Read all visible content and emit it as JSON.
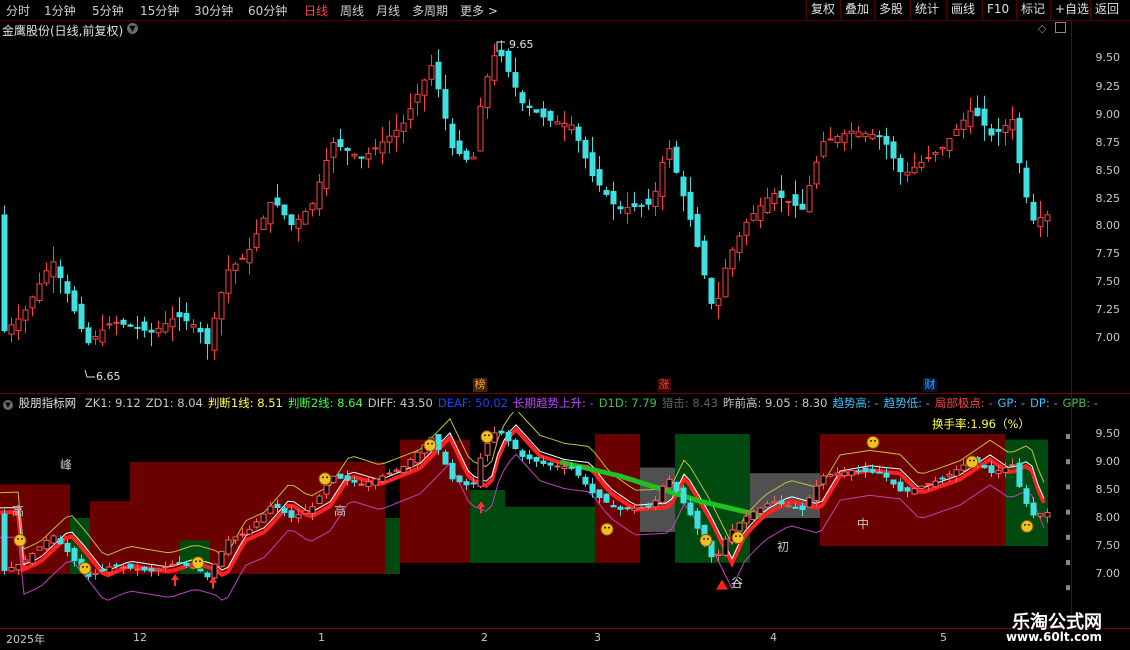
{
  "topbar": {
    "periods": [
      "分时",
      "1分钟",
      "5分钟",
      "15分钟",
      "30分钟",
      "60分钟",
      "日线",
      "周线",
      "月线",
      "多周期",
      "更多 >"
    ],
    "active_index": 6,
    "right_buttons": [
      "复权",
      "叠加",
      "多股",
      "统计",
      "画线",
      "F10",
      "标记",
      "+自选",
      "返回"
    ]
  },
  "stock": {
    "title": "金鹰股份(日线,前复权)",
    "high_mark": "9.65",
    "low_mark": "6.65"
  },
  "price_axis": [
    "9.50",
    "9.25",
    "9.00",
    "8.75",
    "8.50",
    "8.25",
    "8.00",
    "7.75",
    "7.50",
    "7.25",
    "7.00"
  ],
  "events": [
    {
      "label": "榜",
      "color": "#c08000"
    },
    {
      "label": "涨",
      "color": "#e04040"
    },
    {
      "label": "财",
      "color": "#2080ff"
    }
  ],
  "indicator": {
    "name": "股朋指标网",
    "items": [
      {
        "text": "ZK1: 9.12",
        "color": "#c8c8c8"
      },
      {
        "text": "ZD1: 8.04",
        "color": "#c8c8c8"
      },
      {
        "text": "判断1线: 8.51",
        "color": "#ffff40"
      },
      {
        "text": "判断2线: 8.64",
        "color": "#40ff40"
      },
      {
        "text": "DIFF: 43.50",
        "color": "#c8c8c8"
      },
      {
        "text": "DEAF: 50.02",
        "color": "#2040ff"
      },
      {
        "text": "长期趋势上升: -",
        "color": "#c040ff"
      },
      {
        "text": "D1D: 7.79",
        "color": "#40c040"
      },
      {
        "text": "猎击: 8.43",
        "color": "#606060"
      },
      {
        "text": "昨前高: 9.05 : 8.30",
        "color": "#c8c8c8"
      },
      {
        "text": "趋势高: -",
        "color": "#40c0ff"
      },
      {
        "text": "趋势低: -",
        "color": "#40c0ff"
      },
      {
        "text": "局部极点: -",
        "color": "#ff4040"
      },
      {
        "text": "GP: -",
        "color": "#40c0ff"
      },
      {
        "text": "DP: -",
        "color": "#40c0ff"
      },
      {
        "text": "GPB: -",
        "color": "#40c040"
      }
    ],
    "turnover": "换手率:1.96（%）",
    "axis": [
      "9.50",
      "9.00",
      "8.50",
      "8.00",
      "7.50",
      "7.00"
    ],
    "zone_labels": [
      "高",
      "高",
      "中",
      "初",
      "峰",
      "谷"
    ]
  },
  "dates": [
    "2025年",
    "12",
    "1",
    "2",
    "3",
    "4",
    "5"
  ],
  "watermark": {
    "name": "乐淘公式网",
    "url": "www.60lt.com"
  },
  "colors": {
    "up": "#ff4040",
    "down": "#40e0e0",
    "bg": "#000000",
    "grid": "#7a0000"
  }
}
